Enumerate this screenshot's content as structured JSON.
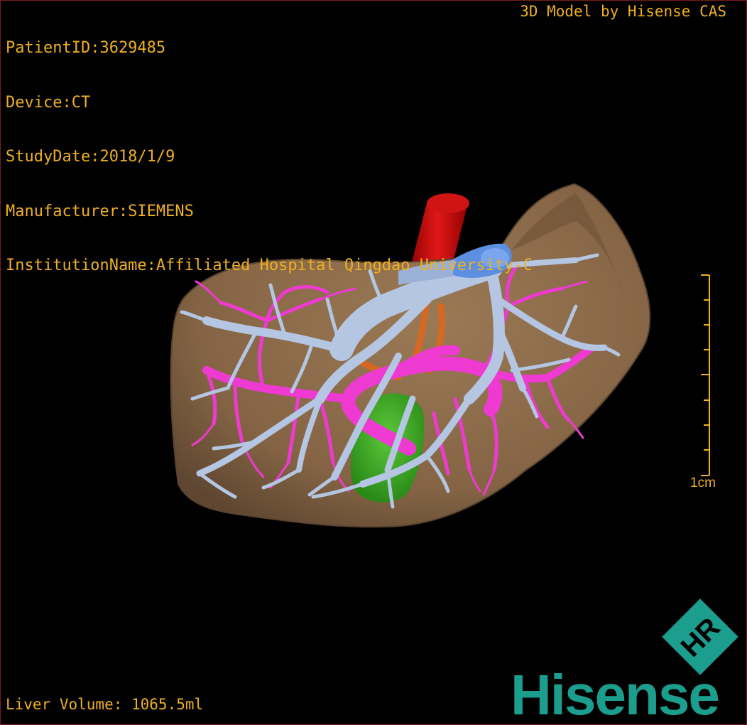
{
  "header": {
    "patient_id": "PatientID:3629485",
    "device": "Device:CT",
    "study_date": "StudyDate:2018/1/9",
    "manufacturer": "Manufacturer:SIEMENS",
    "institution": "InstitutionName:Affiliated Hospital Qingdao University-C"
  },
  "credit": "3D Model by Hisense CAS",
  "scale_bar": {
    "label": "1cm"
  },
  "footer": {
    "liver_volume": "Liver Volume: 1065.5ml"
  },
  "brand": {
    "name": "Hisense",
    "logo_letters": "HR",
    "color": "#1c9e8e"
  },
  "colors": {
    "text": "#f0b020",
    "liver": "#8a6a48",
    "hepatic_vein": "#b4c6e2",
    "portal_vein": "#ee3ad0",
    "ivc_upper": "#5d8fe0",
    "aorta": "#cc1010",
    "gallbladder": "#3cae22",
    "border": "#7a1a1a"
  },
  "structures": [
    "liver",
    "hepatic-vein",
    "portal-vein",
    "inferior-vena-cava",
    "aorta",
    "gallbladder"
  ]
}
